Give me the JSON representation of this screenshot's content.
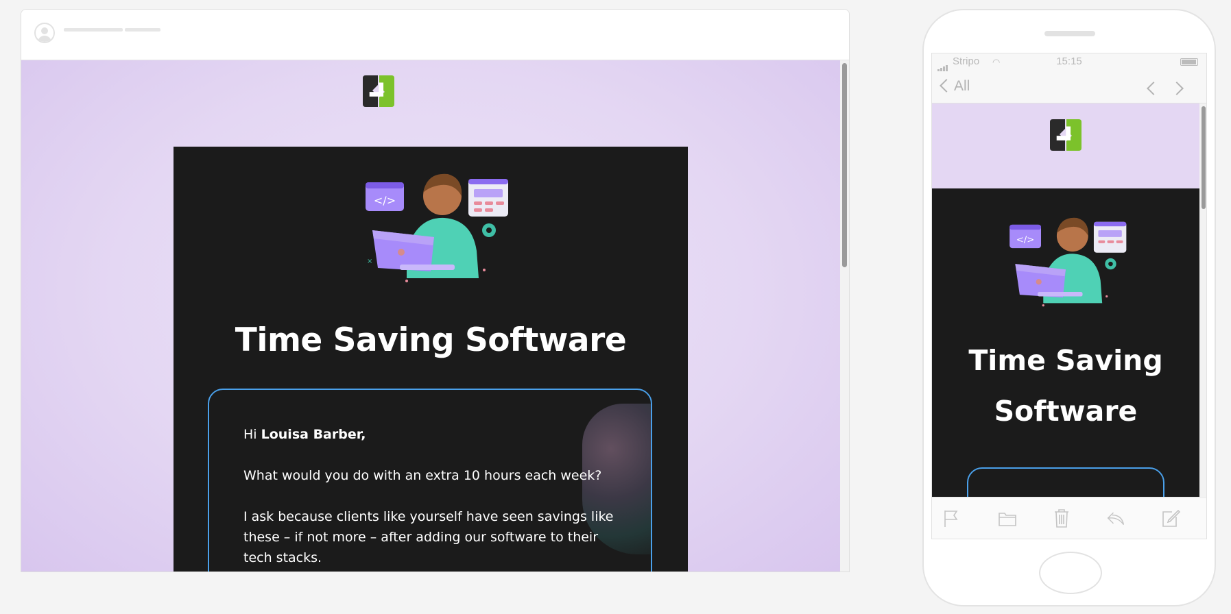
{
  "desktop": {
    "title": "Time Saving Software",
    "greeting_prefix": "Hi",
    "recipient_name": "Louisa Barber,",
    "para1": "What would you do with an extra 10 hours each week?",
    "para2": "I ask because clients like yourself have seen savings like these – if not more – after adding our software to their tech stacks."
  },
  "mobile": {
    "carrier": "Stripo",
    "time": "15:15",
    "back_label": "All",
    "title_line1": "Time Saving",
    "title_line2": "Software"
  },
  "colors": {
    "brand_green": "#7cc22b",
    "brand_dark": "#2a2a2a",
    "card_bg": "#1b1b1b",
    "accent_purple": "#9b7ef0",
    "box_border": "#4aa0ea",
    "header_lilac": "#e4d7f3"
  },
  "icons": {
    "toolbar": [
      "flag-icon",
      "folder-icon",
      "trash-icon",
      "reply-icon",
      "compose-icon"
    ]
  }
}
